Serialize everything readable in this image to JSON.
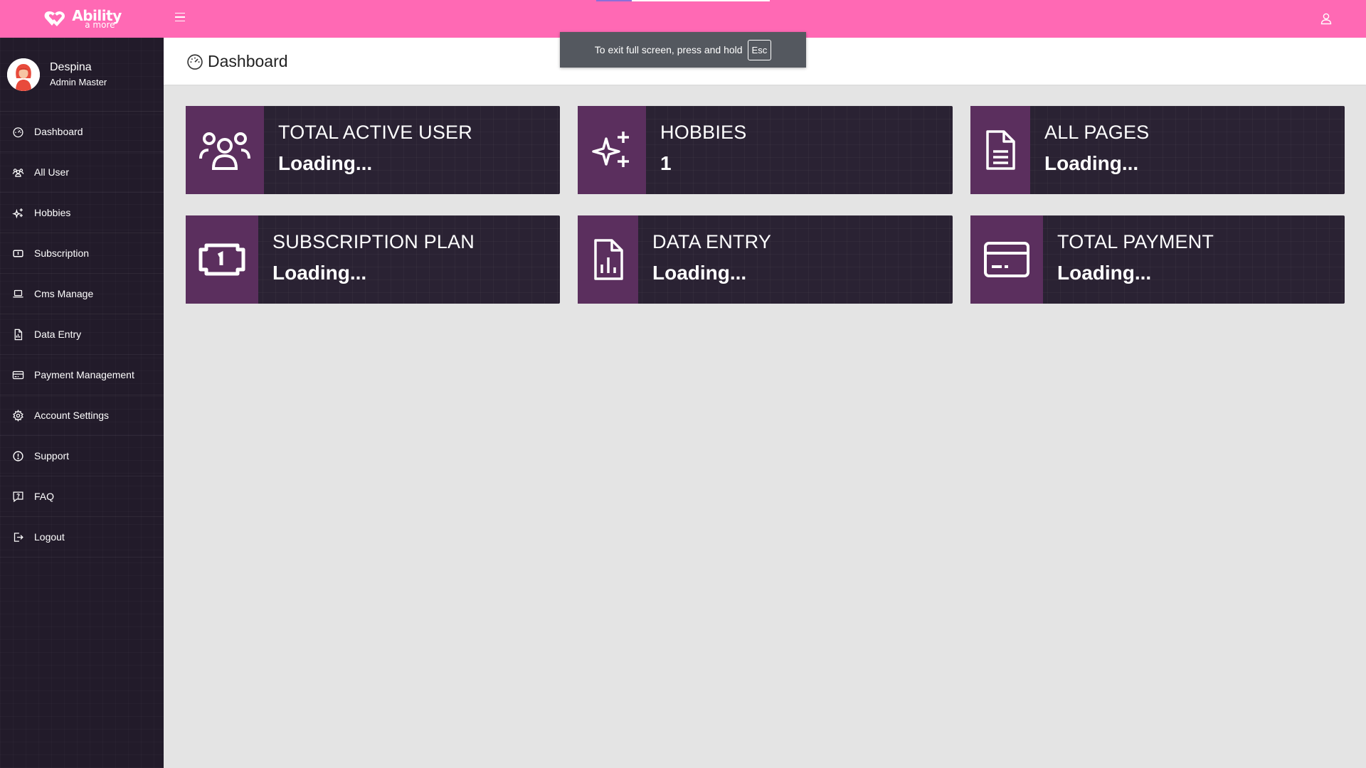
{
  "app": {
    "logo_main": "Ability",
    "logo_sub": "a more"
  },
  "profile": {
    "name": "Despina",
    "role": "Admin Master"
  },
  "sidebar": {
    "items": [
      {
        "label": "Dashboard",
        "icon": "dashboard-icon"
      },
      {
        "label": "All User",
        "icon": "users-icon"
      },
      {
        "label": "Hobbies",
        "icon": "sparkles-icon"
      },
      {
        "label": "Subscription",
        "icon": "money-icon"
      },
      {
        "label": "Cms Manage",
        "icon": "laptop-icon"
      },
      {
        "label": "Data Entry",
        "icon": "file-chart-icon"
      },
      {
        "label": "Payment Management",
        "icon": "credit-card-icon"
      },
      {
        "label": "Account Settings",
        "icon": "gear-icon"
      },
      {
        "label": "Support",
        "icon": "info-icon"
      },
      {
        "label": "FAQ",
        "icon": "chat-question-icon"
      },
      {
        "label": "Logout",
        "icon": "logout-icon"
      }
    ]
  },
  "header": {
    "title": "Dashboard",
    "icon": "dashboard-icon"
  },
  "fullscreen_notice": {
    "text": "To exit full screen, press and hold",
    "key": "Esc"
  },
  "cards": [
    {
      "label": "TOTAL ACTIVE USER",
      "value": "Loading...",
      "icon": "users-icon"
    },
    {
      "label": "HOBBIES",
      "value": "1",
      "icon": "sparkles-icon"
    },
    {
      "label": "ALL PAGES",
      "value": "Loading...",
      "icon": "document-icon"
    },
    {
      "label": "SUBSCRIPTION PLAN",
      "value": "Loading...",
      "icon": "money-icon"
    },
    {
      "label": "DATA ENTRY",
      "value": "Loading...",
      "icon": "file-chart-icon"
    },
    {
      "label": "TOTAL PAYMENT",
      "value": "Loading...",
      "icon": "credit-card-icon"
    }
  ],
  "colors": {
    "topbar": "#ff69b4",
    "sidebar": "#221b2a",
    "card_bg": "#2a2233",
    "card_icon_bg": "#5b2f5e",
    "content_bg": "#e4e4e4"
  }
}
